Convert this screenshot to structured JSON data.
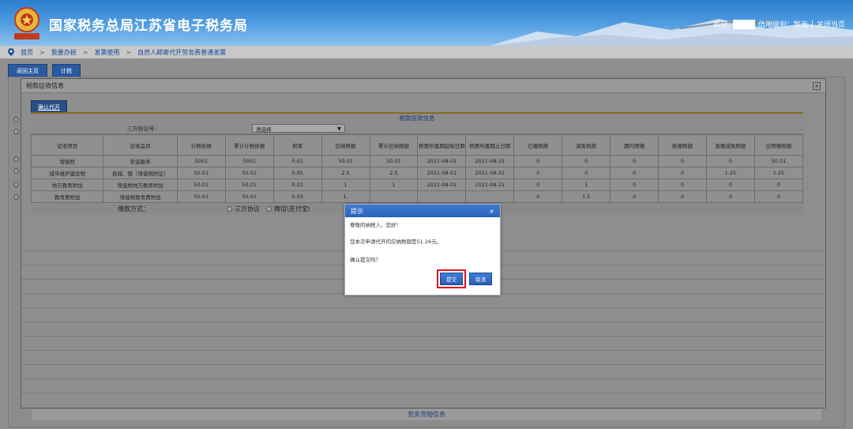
{
  "header": {
    "site_title": "国家税务总局江苏省电子税务局",
    "welcome": "欢迎,",
    "credit_label": "信用级别：暂无",
    "close_label": "关闭当页",
    "separator": "|"
  },
  "breadcrumb": {
    "items": [
      "首页",
      "我要办税",
      "发票使用",
      "自然人邮寄代开劳务费普通发票"
    ],
    "separator": ">"
  },
  "toolbar": {
    "back_label": "返回主页",
    "calc_label": "计税"
  },
  "window": {
    "title": "税款征收信息",
    "close_label": "x",
    "confirm_label": "确认代开",
    "section_title": "税款征收信息",
    "agreement_label": "三方协议号:",
    "agreement_value": "请选择",
    "table": {
      "headers": [
        "征收项目",
        "征收品目",
        "计税依据",
        "累计计税依据",
        "税率",
        "应纳税额",
        "累计应纳税额",
        "税费所属期起始日期",
        "税费所属期止日期",
        "已缴税额",
        "减免税额",
        "期内预缴",
        "抵缴税额",
        "查缴减免税额",
        "应预缴税额"
      ],
      "rows": [
        [
          "增值税",
          "安装服务",
          "5001",
          "5001",
          "0.01",
          "50.01",
          "50.01",
          "2021-08-01",
          "2021-08-31",
          "0",
          "0",
          "0",
          "0",
          "0",
          "50.01"
        ],
        [
          "城市维护建设税",
          "县城、镇（增值税附征）",
          "50.01",
          "50.01",
          "0.05",
          "2.5",
          "2.5",
          "2021-08-01",
          "2021-08-31",
          "0",
          "0",
          "0",
          "0",
          "1.25",
          "1.25"
        ],
        [
          "地方教育附加",
          "增值税地方教育附加",
          "50.01",
          "50.01",
          "0.02",
          "1",
          "1",
          "2021-08-01",
          "2021-08-31",
          "0",
          "1",
          "0",
          "0",
          "0",
          "0"
        ],
        [
          "教育费附加",
          "增值税教育费附加",
          "50.01",
          "50.01",
          "0.03",
          "1.",
          "",
          "",
          "",
          "0",
          "1.5",
          "0",
          "0",
          "0",
          "0"
        ]
      ]
    },
    "payment_label": "缴款方式：",
    "payment_options": [
      "三方协议",
      "微信\\支付宝\\"
    ]
  },
  "footer_section": "劳务货物信息",
  "dialog": {
    "title": "提示",
    "close_label": "×",
    "greeting": "尊敬的纳税人，您好！",
    "message": "您本次申请代开的应纳税额是51.26元。",
    "question": "确认提交吗？",
    "submit_label": "提交",
    "cancel_label": "取消"
  },
  "colors": {
    "header_blue": "#2c7fcf",
    "dialog_blue": "#2b63b8",
    "highlight_red": "#e0161c"
  }
}
